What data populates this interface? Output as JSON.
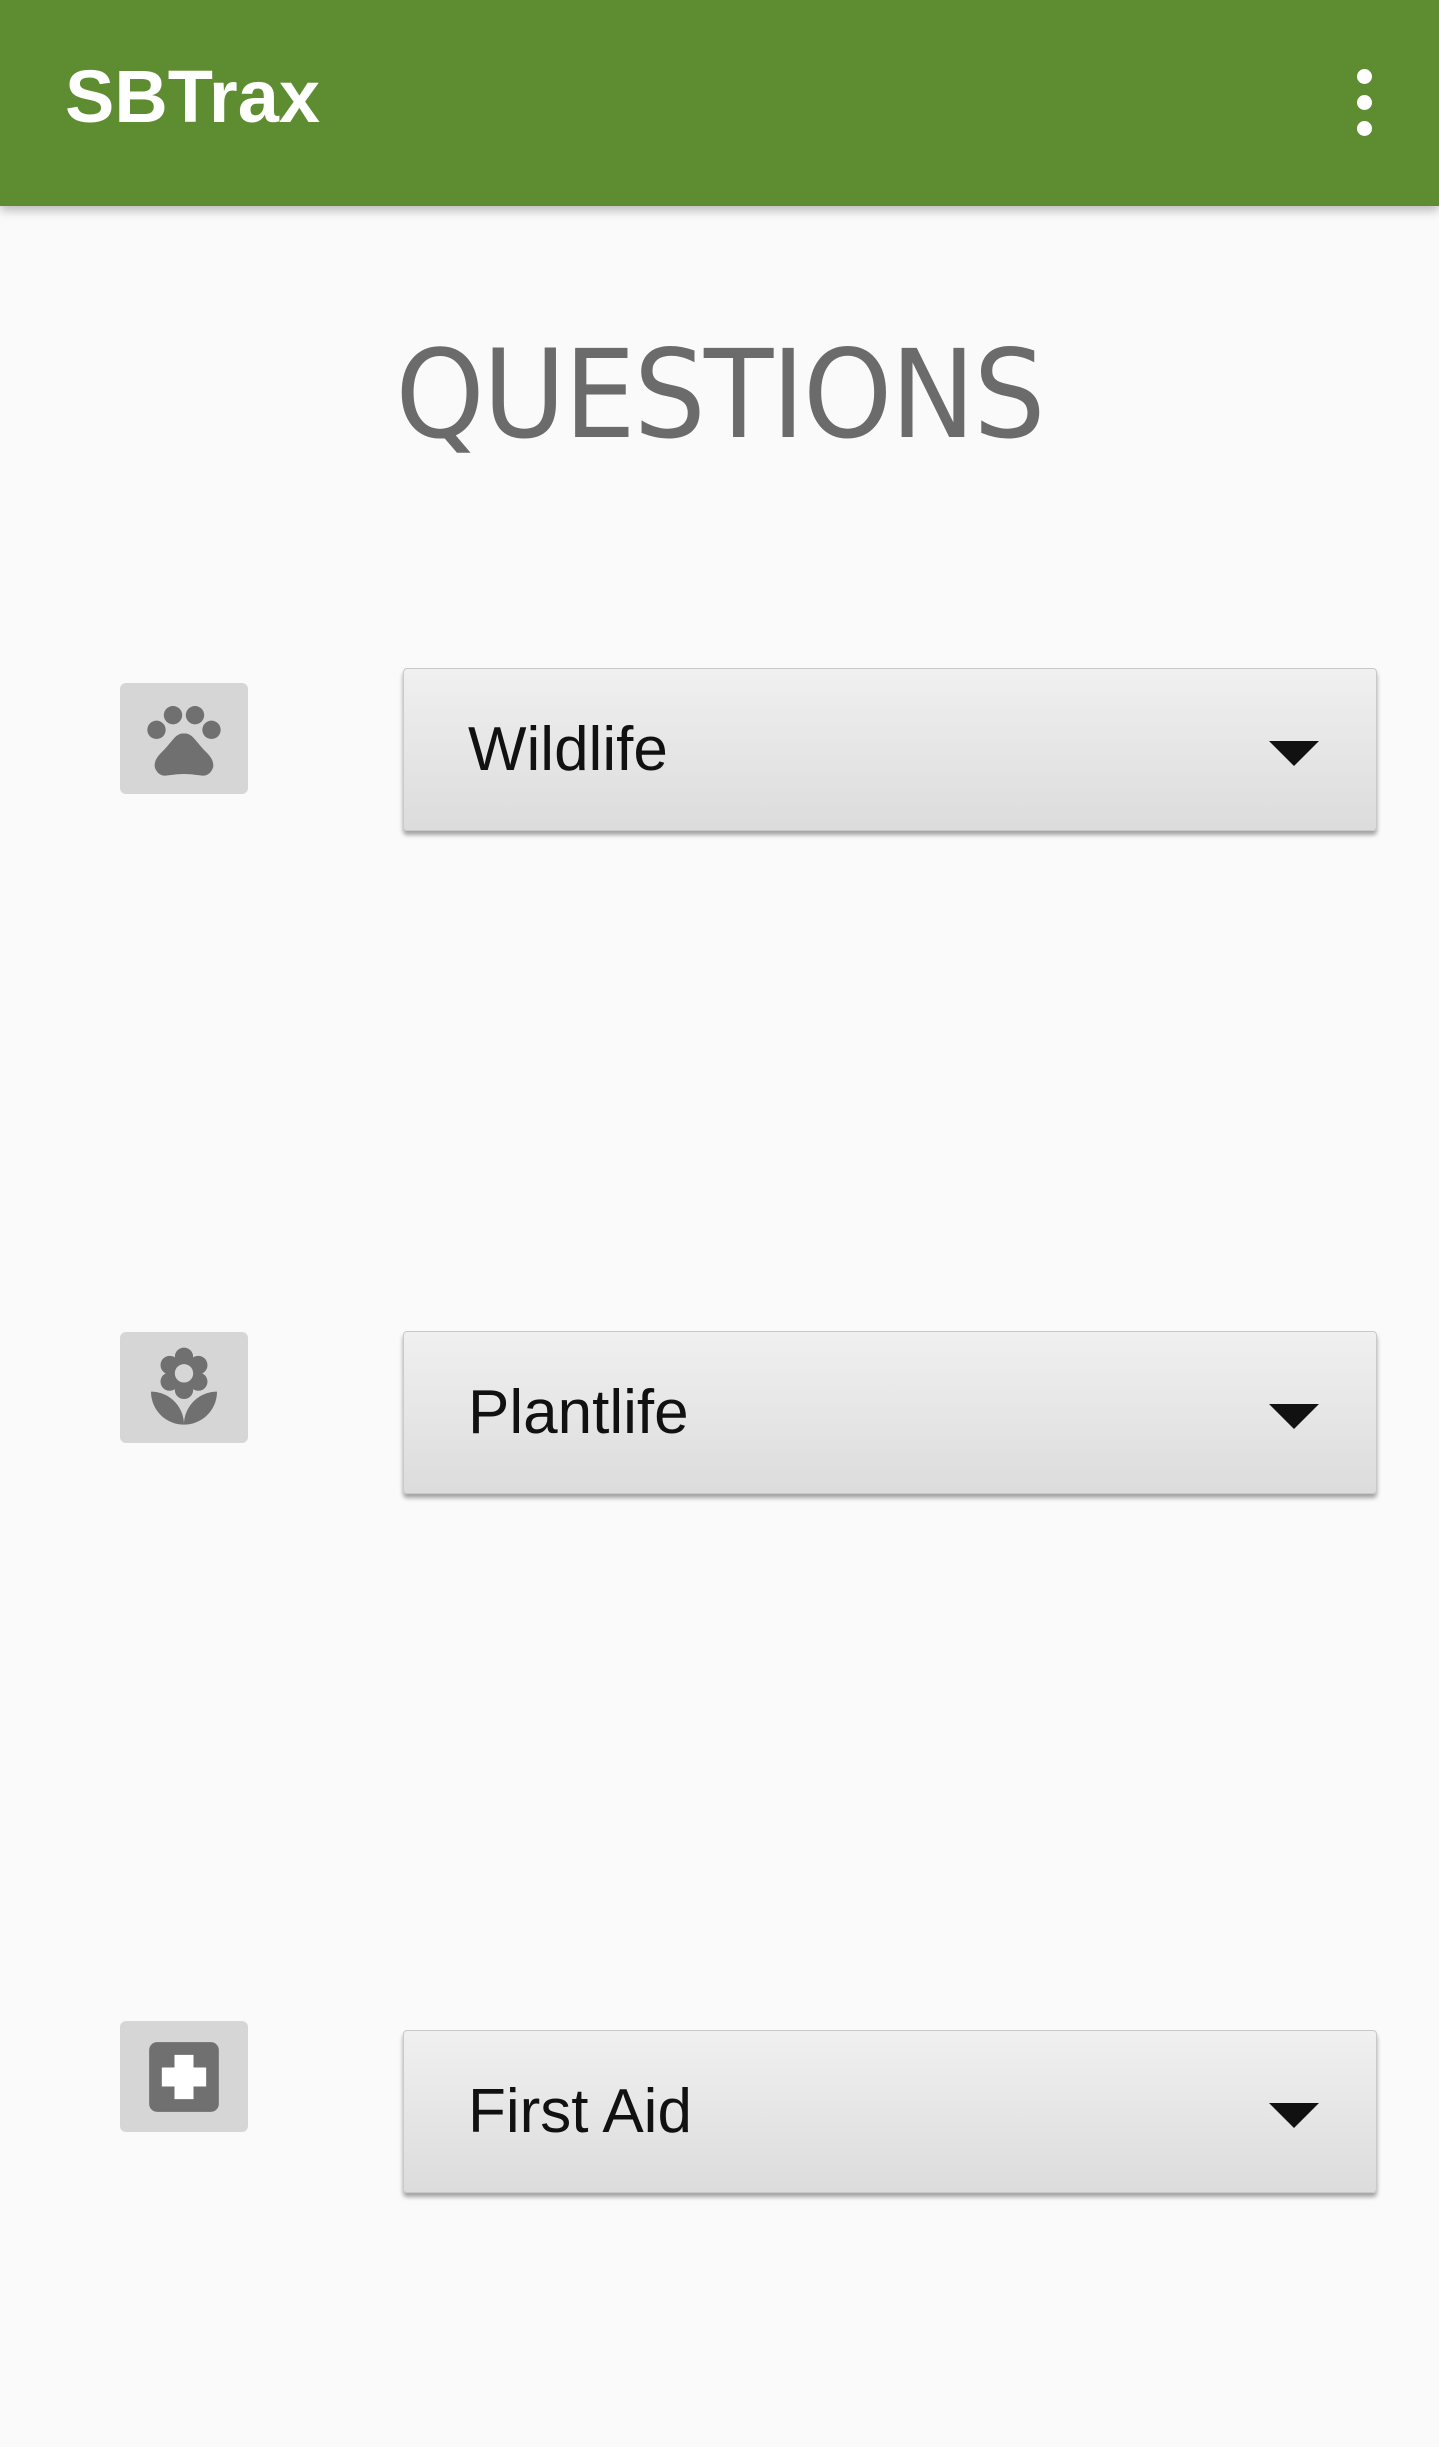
{
  "app_bar": {
    "title": "SBTrax",
    "overflow_icon": "more-vert-icon",
    "background_color": "#5e8c31"
  },
  "heading": "QUESTIONS",
  "categories": [
    {
      "icon": "paw-icon",
      "selected": "Wildlife"
    },
    {
      "icon": "flower-icon",
      "selected": "Plantlife"
    },
    {
      "icon": "first-aid-icon",
      "selected": "First Aid"
    }
  ],
  "colors": {
    "icon_fg": "#707070",
    "icon_bg": "#d6d6d6",
    "heading": "#6b6b6b"
  }
}
